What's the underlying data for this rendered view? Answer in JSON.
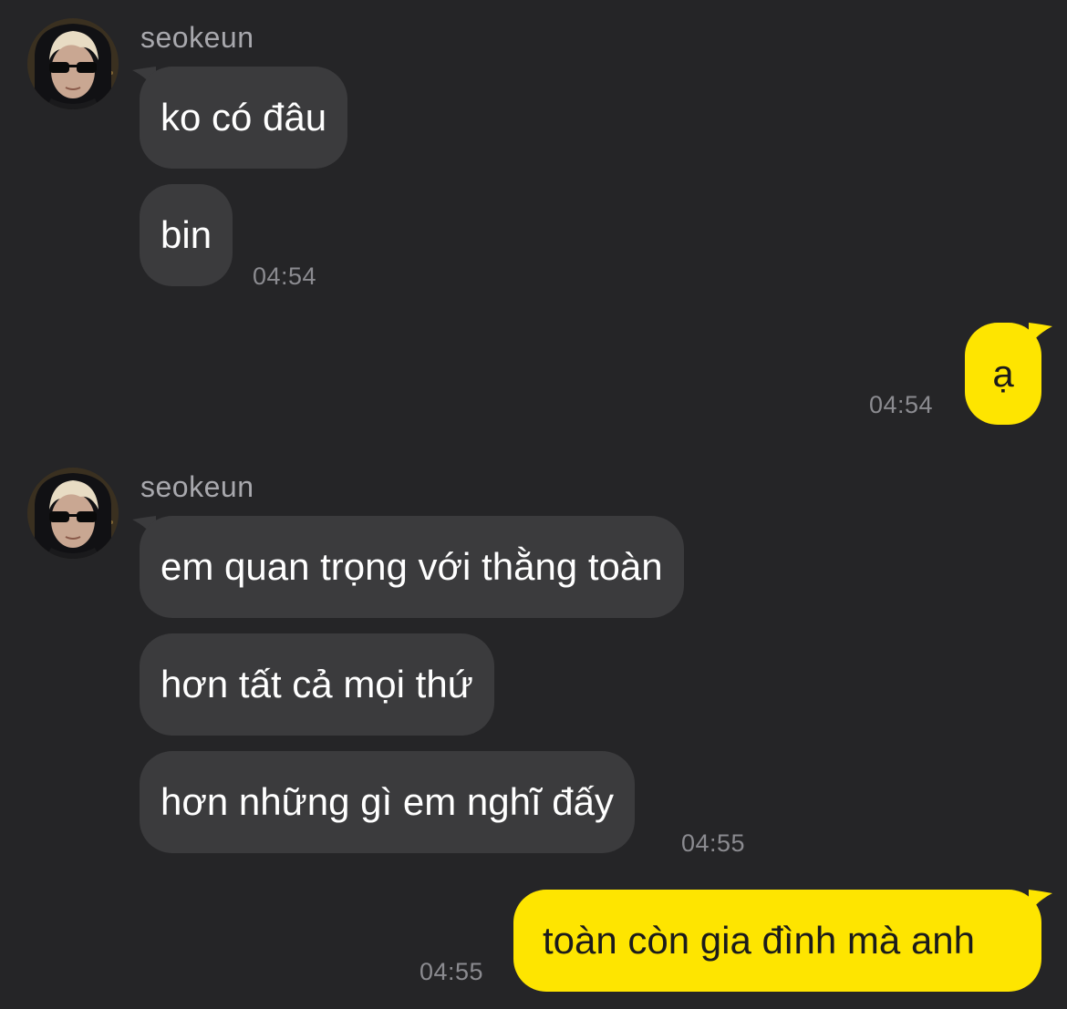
{
  "colors": {
    "background": "#252527",
    "incoming_bubble": "#3b3b3d",
    "outgoing_bubble": "#fee500",
    "timestamp": "#8b8b90",
    "sender_name": "#a8a8ad"
  },
  "groups": [
    {
      "sender": "seokeun",
      "messages": [
        "ko có đâu",
        "bin"
      ],
      "time": "04:54"
    },
    {
      "outgoing": true,
      "messages": [
        "ạ"
      ],
      "time": "04:54"
    },
    {
      "sender": "seokeun",
      "messages": [
        "em quan trọng với thằng toàn",
        "hơn tất cả mọi thứ",
        "hơn những gì em nghĩ đấy"
      ],
      "time": "04:55"
    },
    {
      "outgoing": true,
      "messages": [
        "toàn còn gia đình mà anh"
      ],
      "time": "04:55"
    }
  ]
}
